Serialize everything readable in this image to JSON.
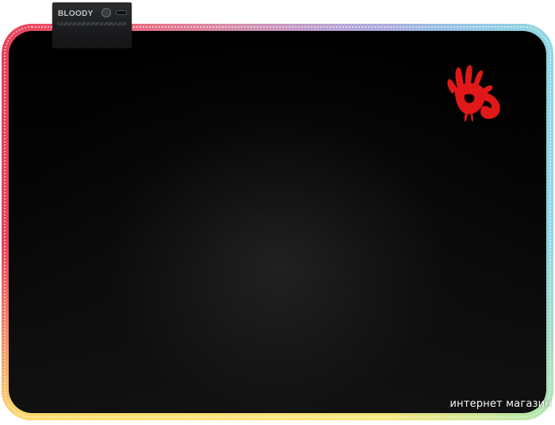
{
  "image": {
    "subject": "rgb-mouse-pad",
    "controller": {
      "brand": "BLOODY"
    },
    "watermark": {
      "text": "интернет магазин"
    },
    "colors": {
      "surface": "#000000",
      "logo": "#e01818",
      "edge_left": "#e8405a",
      "edge_right": "#a8c8f0",
      "edge_bottom": "#ffee6e"
    },
    "icons": [
      "bloody-hand-logo-icon",
      "power-button-icon",
      "usb-port-icon"
    ]
  }
}
